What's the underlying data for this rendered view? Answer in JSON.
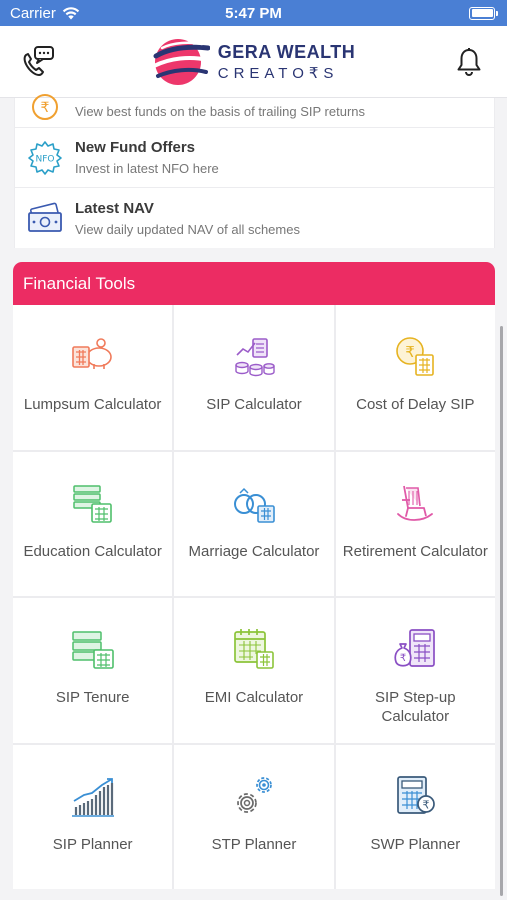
{
  "status_bar": {
    "carrier": "Carrier",
    "time": "5:47 PM"
  },
  "header": {
    "brand_line1": "GERA WEALTH",
    "brand_line2": "CREATO₹S",
    "left_icon": "chat-phone-icon",
    "right_icon": "bell-icon"
  },
  "list": [
    {
      "title": "",
      "subtitle": "View best funds on the basis of trailing SIP returns",
      "icon": "rupee-coin-icon"
    },
    {
      "title": "New Fund Offers",
      "subtitle": "Invest in latest NFO here",
      "icon": "nfo-badge-icon"
    },
    {
      "title": "Latest NAV",
      "subtitle": "View daily updated NAV of all schemes",
      "icon": "cash-notes-icon"
    }
  ],
  "tools": {
    "title": "Financial Tools",
    "items": [
      {
        "label": "Lumpsum Calculator",
        "icon": "piggy-bank-calculator-icon",
        "color": "#f07a5a"
      },
      {
        "label": "SIP Calculator",
        "icon": "coins-chart-icon",
        "color": "#9b5cc9"
      },
      {
        "label": "Cost of Delay SIP",
        "icon": "rupee-clock-calculator-icon",
        "color": "#e6b321"
      },
      {
        "label": "Education Calculator",
        "icon": "book-calculator-icon",
        "color": "#4fbf6b"
      },
      {
        "label": "Marriage Calculator",
        "icon": "rings-calculator-icon",
        "color": "#3a8fd4"
      },
      {
        "label": "Retirement Calculator",
        "icon": "rocking-chair-icon",
        "color": "#e05aa8"
      },
      {
        "label": "SIP Tenure",
        "icon": "calendar-calculator-icon",
        "color": "#4fbf6b"
      },
      {
        "label": "EMI Calculator",
        "icon": "calendar-grid-calculator-icon",
        "color": "#8cc43a"
      },
      {
        "label": "SIP Step-up Calculator",
        "icon": "money-bag-calculator-icon",
        "color": "#8a4fc4"
      },
      {
        "label": "SIP Planner",
        "icon": "growth-bars-icon",
        "color": "#3a8fd4"
      },
      {
        "label": "STP Planner",
        "icon": "gears-icon",
        "color": "#3a8fd4"
      },
      {
        "label": "SWP Planner",
        "icon": "calculator-rupee-icon",
        "color": "#3a8fd4"
      }
    ]
  }
}
